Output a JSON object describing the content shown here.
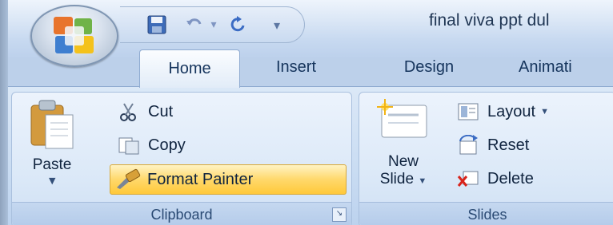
{
  "window": {
    "title": "final viva ppt dul"
  },
  "quick_access": {
    "save_icon": "save-icon",
    "undo_icon": "undo-icon",
    "undo_dropdown": "▾",
    "redo_icon": "redo-icon",
    "customize": "▾"
  },
  "tabs": [
    {
      "label": "Home",
      "active": true
    },
    {
      "label": "Insert",
      "active": false
    },
    {
      "label": "Design",
      "active": false
    },
    {
      "label": "Animati",
      "active": false
    }
  ],
  "ribbon": {
    "clipboard": {
      "group_label": "Clipboard",
      "paste_label": "Paste",
      "cut_label": "Cut",
      "copy_label": "Copy",
      "format_painter_label": "Format Painter"
    },
    "slides": {
      "group_label": "Slides",
      "new_slide_line1": "New",
      "new_slide_line2": "Slide",
      "layout_label": "Layout",
      "reset_label": "Reset",
      "delete_label": "Delete"
    }
  },
  "colors": {
    "accent_hover": "#ffd86b",
    "tab_text": "#15345c",
    "ribbon_bg": "#dce9f8"
  }
}
